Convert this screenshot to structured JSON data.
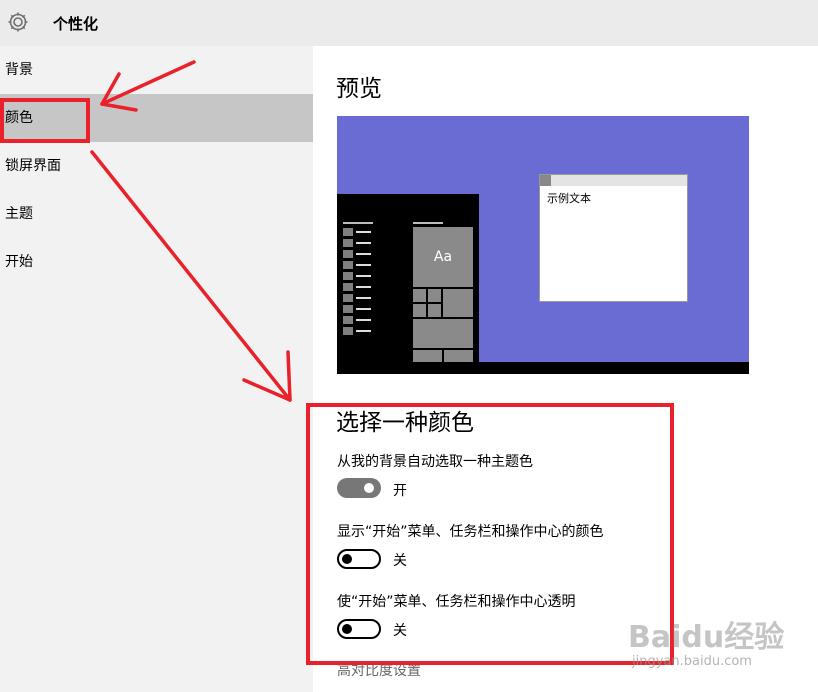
{
  "window": {
    "title": "个性化",
    "icon": "gear-icon"
  },
  "sidebar": {
    "items": [
      {
        "label": "背景",
        "active": false
      },
      {
        "label": "颜色",
        "active": true
      },
      {
        "label": "锁屏界面",
        "active": false
      },
      {
        "label": "主题",
        "active": false
      },
      {
        "label": "开始",
        "active": false
      }
    ]
  },
  "preview": {
    "heading": "预览",
    "window_text": "示例文本",
    "tile_text": "Aa",
    "accent_color": "#6b6bd4"
  },
  "colors": {
    "heading": "选择一种颜色",
    "settings": [
      {
        "label": "从我的背景自动选取一种主题色",
        "state": "开",
        "on": true
      },
      {
        "label": "显示“开始”菜单、任务栏和操作中心的颜色",
        "state": "关",
        "on": false
      },
      {
        "label": "使“开始”菜单、任务栏和操作中心透明",
        "state": "关",
        "on": false
      }
    ],
    "high_contrast_link": "高对比度设置"
  },
  "watermark": {
    "brand": "Baidu经验",
    "site": "jingyan.baidu.com"
  },
  "annotation_color": "#e8212a"
}
